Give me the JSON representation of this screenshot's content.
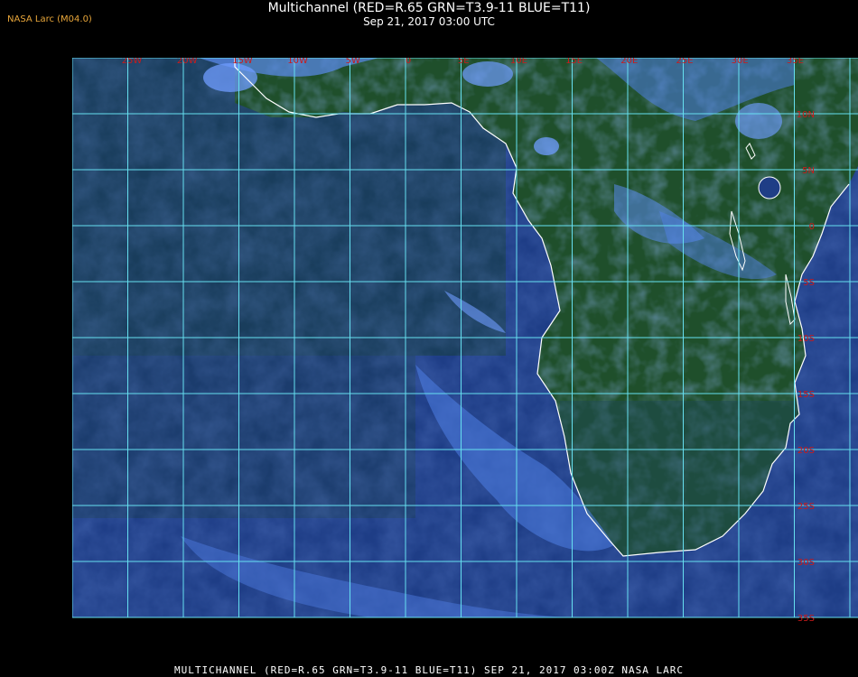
{
  "header": {
    "credit": "NASA Larc (M04.0)",
    "title": "Multichannel (RED=R.65 GRN=T3.9-11 BLUE=T11)",
    "timestamp": "Sep 21, 2017 03:00 UTC"
  },
  "map": {
    "longitude_labels": [
      "25W",
      "20W",
      "15W",
      "10W",
      "5W",
      "0",
      "5E",
      "10E",
      "15E",
      "20E",
      "25E",
      "30E",
      "35E"
    ],
    "latitude_labels": [
      "10N",
      "5N",
      "0",
      "5S",
      "10S",
      "15S",
      "20S",
      "25S",
      "30S",
      "35S",
      "40S"
    ],
    "grid_color": "#66e0f0",
    "label_color": "#cc1a1a",
    "coastline_color": "#ffffff",
    "ocean_color": "#1f3e8c",
    "land_color": "#1e4d2a",
    "cloud_color": "#4f7fe6"
  },
  "footer": {
    "caption": "MULTICHANNEL (RED=R.65 GRN=T3.9-11 BLUE=T11) SEP 21, 2017 03:00Z   NASA LARC"
  }
}
